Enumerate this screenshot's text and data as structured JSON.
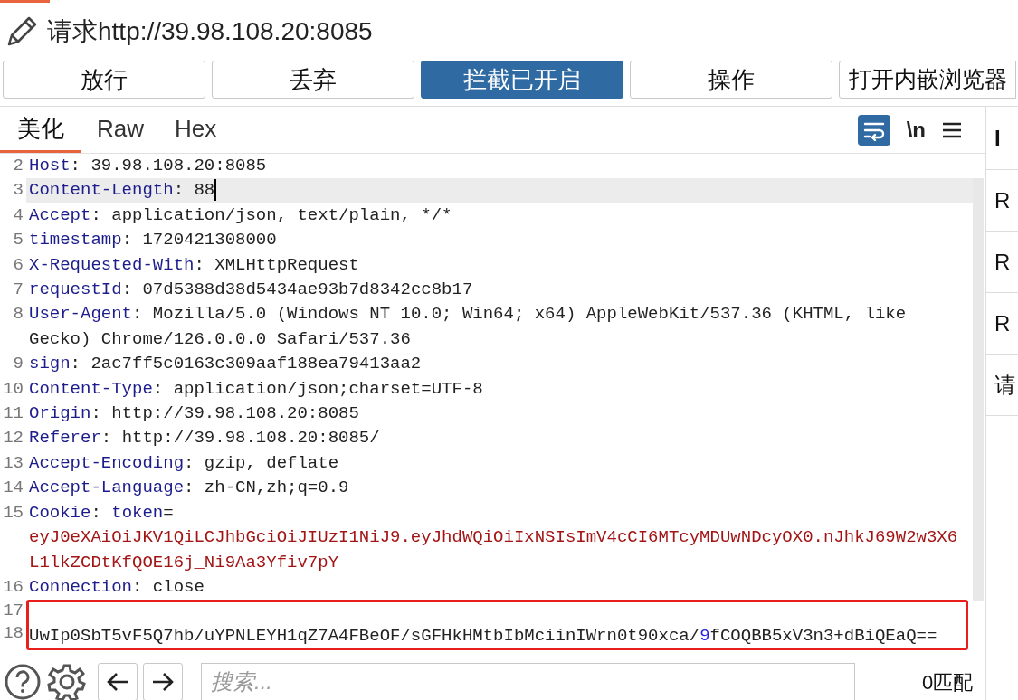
{
  "request_title": "请求http://39.98.108.20:8085",
  "actions": [
    {
      "label": "放行",
      "selected": false
    },
    {
      "label": "丢弃",
      "selected": false
    },
    {
      "label": "拦截已开启",
      "selected": true
    },
    {
      "label": "操作",
      "selected": false
    },
    {
      "label": "打开内嵌浏览器",
      "selected": false
    }
  ],
  "tabs": [
    {
      "label": "美化",
      "selected": true
    },
    {
      "label": "Raw",
      "selected": false
    },
    {
      "label": "Hex",
      "selected": false
    }
  ],
  "toolbar": {
    "wrap_on": true,
    "newline_label": "\\n"
  },
  "lines": [
    {
      "number": "2",
      "current": false,
      "boxed": false,
      "segments": [
        {
          "kind": "key",
          "text": "Host"
        },
        {
          "kind": "plain",
          "text": ": 39.98.108.20:8085"
        }
      ]
    },
    {
      "number": "3",
      "current": true,
      "boxed": false,
      "segments": [
        {
          "kind": "key",
          "text": "Content-Length"
        },
        {
          "kind": "plain",
          "text": ": 88"
        }
      ]
    },
    {
      "number": "4",
      "current": false,
      "boxed": false,
      "segments": [
        {
          "kind": "key",
          "text": "Accept"
        },
        {
          "kind": "plain",
          "text": ": application/json, text/plain, */*"
        }
      ]
    },
    {
      "number": "5",
      "current": false,
      "boxed": false,
      "segments": [
        {
          "kind": "key",
          "text": "timestamp"
        },
        {
          "kind": "plain",
          "text": ": 1720421308000"
        }
      ]
    },
    {
      "number": "6",
      "current": false,
      "boxed": false,
      "segments": [
        {
          "kind": "key",
          "text": "X-Requested-With"
        },
        {
          "kind": "plain",
          "text": ": XMLHttpRequest"
        }
      ]
    },
    {
      "number": "7",
      "current": false,
      "boxed": false,
      "segments": [
        {
          "kind": "key",
          "text": "requestId"
        },
        {
          "kind": "plain",
          "text": ": 07d5388d38d5434ae93b7d8342cc8b17"
        }
      ]
    },
    {
      "number": "8",
      "current": false,
      "boxed": false,
      "segments": [
        {
          "kind": "key",
          "text": "User-Agent"
        },
        {
          "kind": "plain",
          "text": ": Mozilla/5.0 (Windows NT 10.0; Win64; x64) AppleWebKit/537.36 (KHTML, like Gecko) Chrome/126.0.0.0 Safari/537.36"
        }
      ]
    },
    {
      "number": "9",
      "current": false,
      "boxed": false,
      "segments": [
        {
          "kind": "key",
          "text": "sign"
        },
        {
          "kind": "plain",
          "text": ": 2ac7ff5c0163c309aaf188ea79413aa2"
        }
      ]
    },
    {
      "number": "10",
      "current": false,
      "boxed": false,
      "segments": [
        {
          "kind": "key",
          "text": "Content-Type"
        },
        {
          "kind": "plain",
          "text": ": application/json;charset=UTF-8"
        }
      ]
    },
    {
      "number": "11",
      "current": false,
      "boxed": false,
      "segments": [
        {
          "kind": "key",
          "text": "Origin"
        },
        {
          "kind": "plain",
          "text": ": http://39.98.108.20:8085"
        }
      ]
    },
    {
      "number": "12",
      "current": false,
      "boxed": false,
      "segments": [
        {
          "kind": "key",
          "text": "Referer"
        },
        {
          "kind": "plain",
          "text": ": http://39.98.108.20:8085/"
        }
      ]
    },
    {
      "number": "13",
      "current": false,
      "boxed": false,
      "segments": [
        {
          "kind": "key",
          "text": "Accept-Encoding"
        },
        {
          "kind": "plain",
          "text": ": gzip, deflate"
        }
      ]
    },
    {
      "number": "14",
      "current": false,
      "boxed": false,
      "segments": [
        {
          "kind": "key",
          "text": "Accept-Language"
        },
        {
          "kind": "plain",
          "text": ": zh-CN,zh;q=0.9"
        }
      ]
    },
    {
      "number": "15",
      "current": false,
      "boxed": false,
      "segments": [
        {
          "kind": "key",
          "text": "Cookie"
        },
        {
          "kind": "plain",
          "text": ": "
        },
        {
          "kind": "key",
          "text": "token"
        },
        {
          "kind": "plain",
          "text": "="
        },
        {
          "kind": "value",
          "text": "eyJ0eXAiOiJKV1QiLCJhbGciOiJIUzI1NiJ9.eyJhdWQiOiIxNSIsImV4cCI6MTcyMDUwNDcyOX0.nJhkJ69W2w3X6L1lkZCDtKfQOE16j_Ni9Aa3Yfiv7pY"
        }
      ]
    },
    {
      "number": "16",
      "current": false,
      "boxed": false,
      "segments": [
        {
          "kind": "key",
          "text": "Connection"
        },
        {
          "kind": "plain",
          "text": ": close"
        }
      ]
    },
    {
      "number": "17",
      "current": false,
      "boxed": true
    },
    {
      "number": "18",
      "current": false,
      "boxed": true,
      "segments": [
        {
          "kind": "plain",
          "text": "UwIp0SbT5vF5Q7hb/uYPNLEYH1qZ7A4FBeOF/sGFHkHMtbIbMciinIWrn0t90xca/"
        },
        {
          "kind": "match",
          "text": "9"
        },
        {
          "kind": "plain",
          "text": "fCOQBB5xV3n3+dBiQEaQ=="
        }
      ]
    }
  ],
  "side_panel": [
    "I",
    "R",
    "R",
    "R",
    "请"
  ],
  "search": {
    "placeholder": "搜索...",
    "matches": "0匹配"
  }
}
